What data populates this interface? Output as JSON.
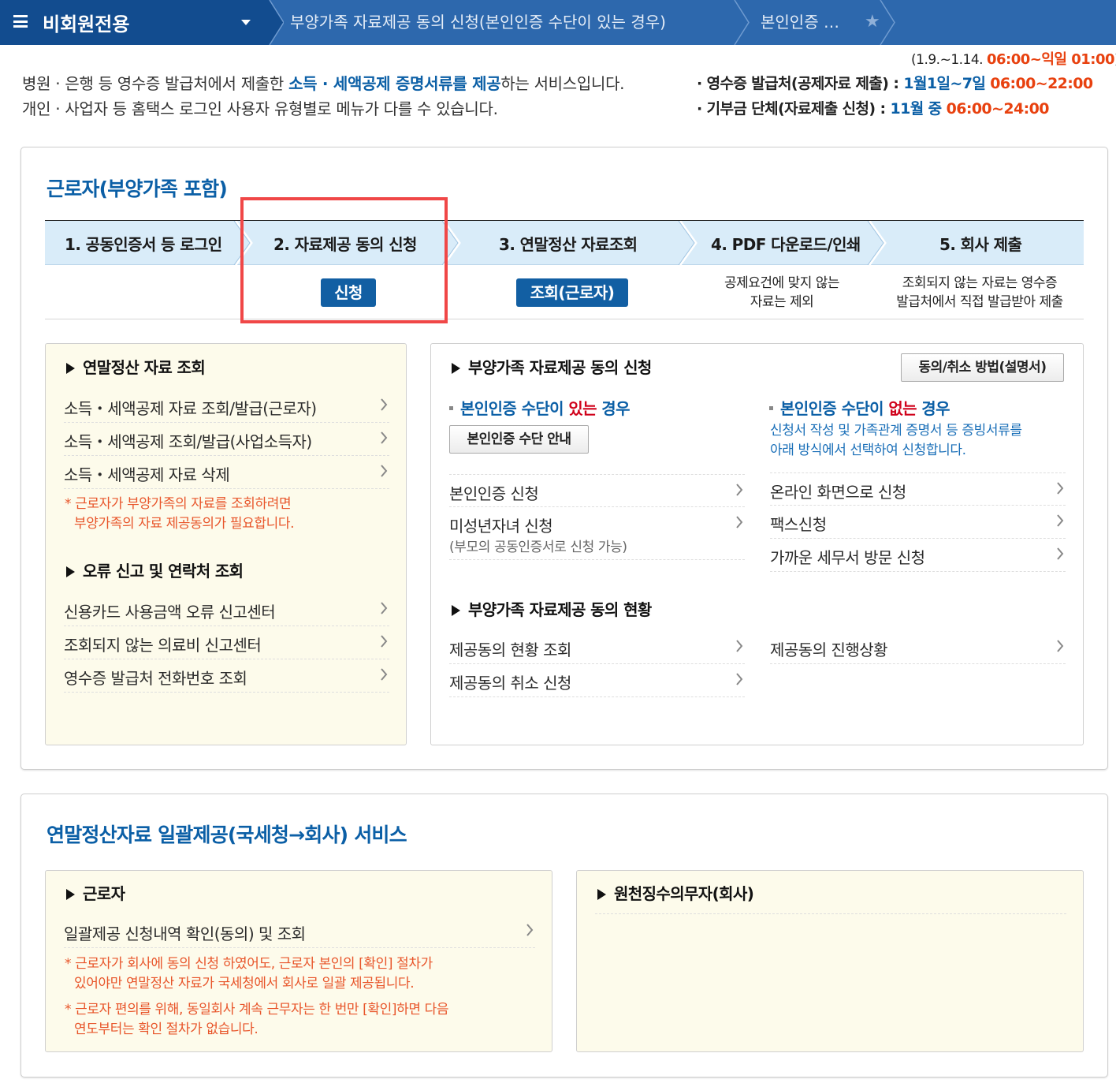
{
  "nav": {
    "menu_title": "비회원전용",
    "breadcrumb1": "부양가족 자료제공 동의 신청(본인인증 수단이 있는 경우)",
    "breadcrumb2": "본인인증 …"
  },
  "intro": {
    "hours_prefix": "(1.9.~1.14. ",
    "hours_value": "06:00~익일 01:00",
    "hours_suffix": ")",
    "line1_a": "병원 · 은행 등 영수증 발급처에서 제출한 ",
    "line1_highlight": "소득 · 세액공제 증명서류를 제공",
    "line1_b": "하는 서비스입니다.",
    "line2": "개인 · 사업자 등 홈택스 로그인 사용자 유형별로 메뉴가 다를 수 있습니다.",
    "info1_label": "· 영수증 발급처(공제자료 제출) : ",
    "info1_period": "1월1일~7일 ",
    "info1_time": "06:00~22:00",
    "info2_label": "· 기부금 단체(자료제출 신청) : ",
    "info2_period": "11월 중 ",
    "info2_time": "06:00~24:00"
  },
  "worker_section": {
    "title": "근로자(부양가족 포함)",
    "steps": [
      {
        "label": "1. 공동인증서 등 로그인"
      },
      {
        "label": "2. 자료제공 동의 신청",
        "button": "신청"
      },
      {
        "label": "3. 연말정산 자료조회",
        "button": "조회(근로자)"
      },
      {
        "label": "4. PDF 다운로드/인쇄",
        "note_line1": "공제요건에 맞지 않는",
        "note_line2": "자료는 제외"
      },
      {
        "label": "5. 회사 제출",
        "note_line1": "조회되지 않는 자료는 영수증",
        "note_line2": "발급처에서 직접 발급받아 제출"
      }
    ],
    "left_box": {
      "title1": "연말정산 자료 조회",
      "links1": [
        "소득・세액공제 자료 조회/발급(근로자)",
        "소득・세액공제 조회/발급(사업소득자)",
        "소득・세액공제 자료 삭제"
      ],
      "note_line1": "* 근로자가 부양가족의 자료를 조회하려면",
      "note_line2": "부양가족의 자료 제공동의가 필요합니다.",
      "title2": "오류 신고 및 연락처 조회",
      "links2": [
        "신용카드 사용금액 오류 신고센터",
        "조회되지 않는 의료비 신고센터",
        "영수증 발급처 전화번호 조회"
      ]
    },
    "right_box": {
      "title1": "부양가족 자료제공 동의 신청",
      "guide_button": "동의/취소 방법(설명서)",
      "with_auth_a": "본인인증 수단이 ",
      "with_auth_red": "있는",
      "with_auth_b": " 경우",
      "auth_guide_button": "본인인증 수단 안내",
      "with_links": [
        "본인인증 신청",
        "미성년자녀 신청"
      ],
      "with_links_sub": "(부모의 공동인증서로 신청 가능)",
      "without_auth_a": "본인인증 수단이 ",
      "without_auth_red": "없는",
      "without_auth_b": " 경우",
      "without_desc_line1": "신청서 작성 및 가족관계 증명서 등 증빙서류를",
      "without_desc_line2": "아래 방식에서 선택하여 신청합니다.",
      "without_links": [
        "온라인 화면으로 신청",
        "팩스신청",
        "가까운 세무서 방문 신청"
      ],
      "title2": "부양가족 자료제공 동의 현황",
      "status_links_left": [
        "제공동의 현황 조회",
        "제공동의 취소 신청"
      ],
      "status_links_right": [
        "제공동의 진행상황"
      ]
    }
  },
  "bulk_section": {
    "title": "연말정산자료 일괄제공(국세청→회사) 서비스",
    "left_title": "근로자",
    "left_link": "일괄제공 신청내역 확인(동의) 및 조회",
    "note1_line1": "* 근로자가 회사에 동의 신청 하였어도, 근로자 본인의 [확인] 절차가",
    "note1_line2": "있어야만 연말정산 자료가 국세청에서 회사로 일괄 제공됩니다.",
    "note2_line1": "* 근로자 편의를 위해, 동일회사 계속 근무자는 한 번만 [확인]하면 다음",
    "note2_line2": "연도부터는 확인 절차가 없습니다.",
    "right_title": "원천징수의무자(회사)"
  },
  "colors": {
    "nav_dark": "#124c8f",
    "nav": "#2d68ad",
    "brand_blue": "#0b5fa6",
    "accent_orange": "#e8410f",
    "highlight_red": "#f04747",
    "step_bg": "#d9ecf9",
    "box_yellow": "#fdfbeb"
  },
  "icons": {
    "menu": "hamburger-icon",
    "dropdown": "caret-down-icon",
    "favorite": "star-icon",
    "link_arrow": "chevron-right-icon",
    "section_marker": "triangle-right-icon"
  }
}
